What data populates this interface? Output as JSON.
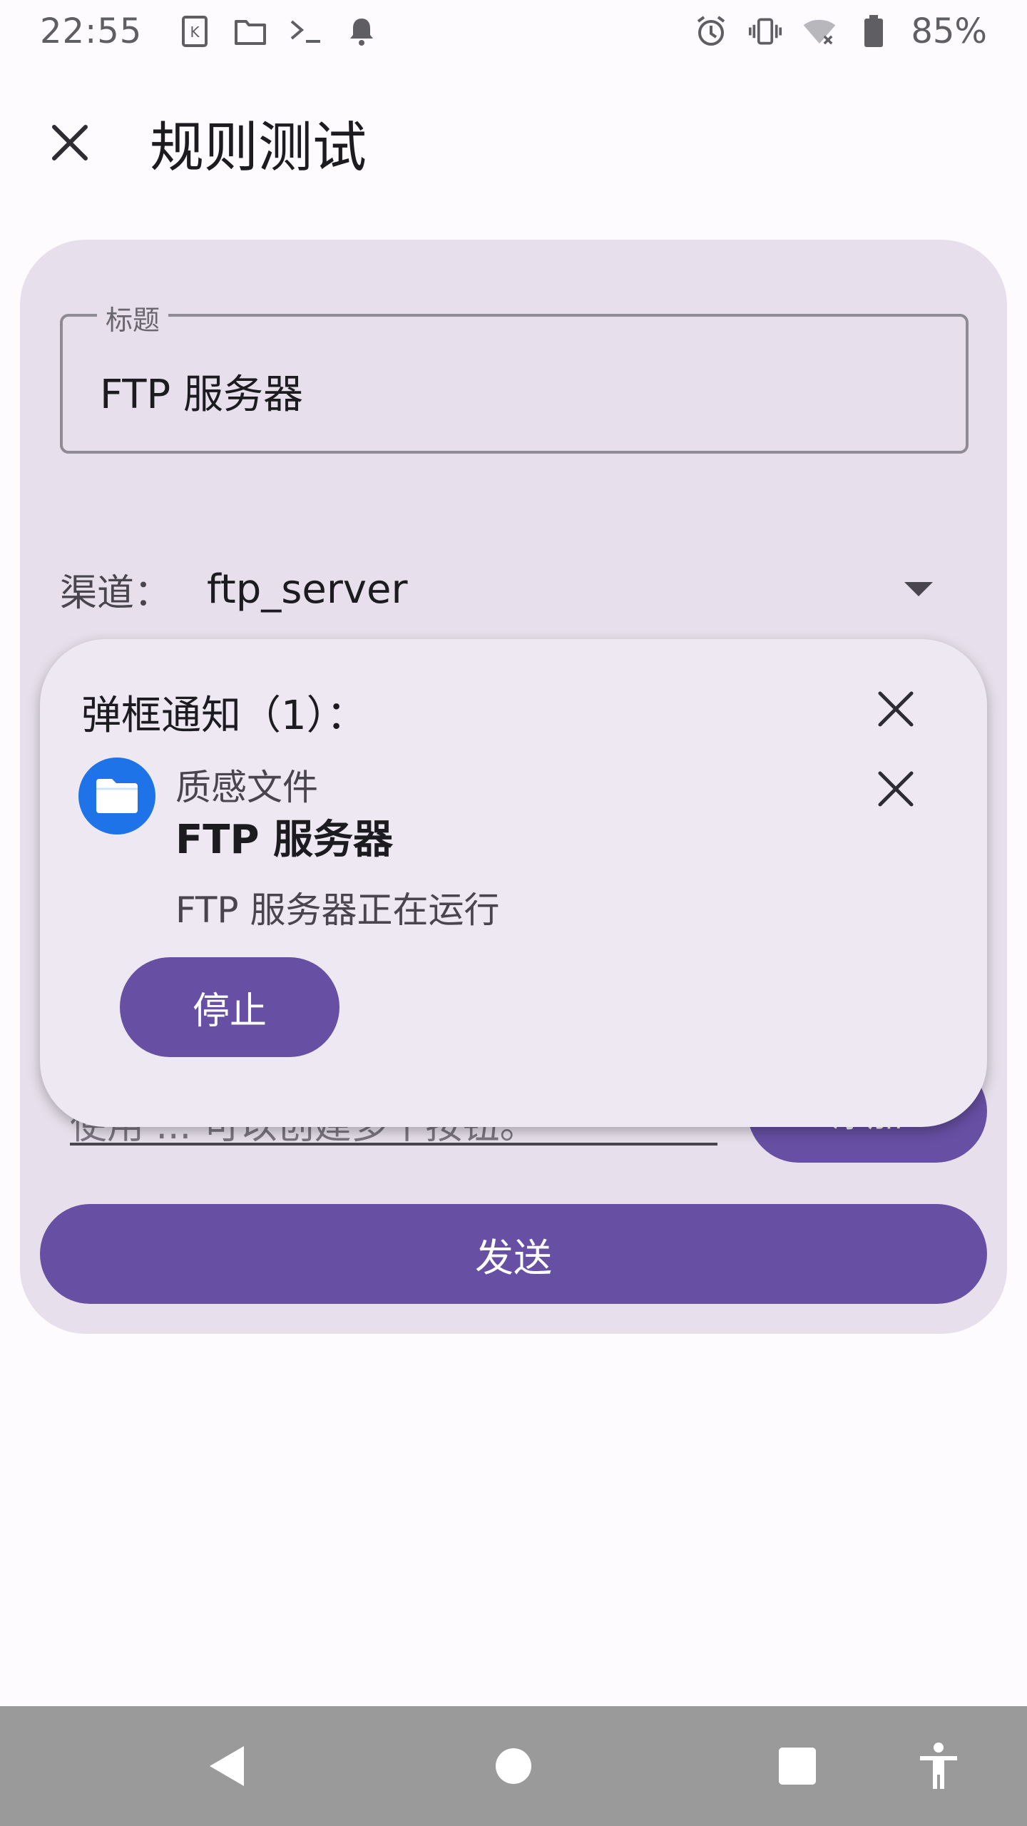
{
  "status_bar": {
    "time": "22:55",
    "left_icons": [
      "k-app-icon",
      "folder-icon",
      "terminal-icon",
      "bell-icon"
    ],
    "right_icons": [
      "alarm-icon",
      "vibrate-icon",
      "wifi-off-icon",
      "battery-icon"
    ],
    "battery": "85%"
  },
  "app_bar": {
    "title": "规则测试",
    "close_icon": "close-icon"
  },
  "form": {
    "title_field": {
      "label": "标题",
      "value": "FTP 服务器"
    },
    "channel": {
      "label": "渠道：",
      "value": "ftp_server"
    },
    "input_hint": "使用 ... 可以创建多个按钮。",
    "add_label": "添加",
    "send_label": "发送"
  },
  "popup": {
    "title": "弹框通知（1）：",
    "app_name": "质感文件",
    "notif_title": "FTP 服务器",
    "notif_text": "FTP 服务器正在运行",
    "action_label": "停止"
  },
  "colors": {
    "accent": "#674fa3",
    "card_bg": "#e7e0ec",
    "popup_bg": "#ede8f2",
    "app_icon_bg": "#1e73e8",
    "nav_bg": "#9a9a9a"
  }
}
